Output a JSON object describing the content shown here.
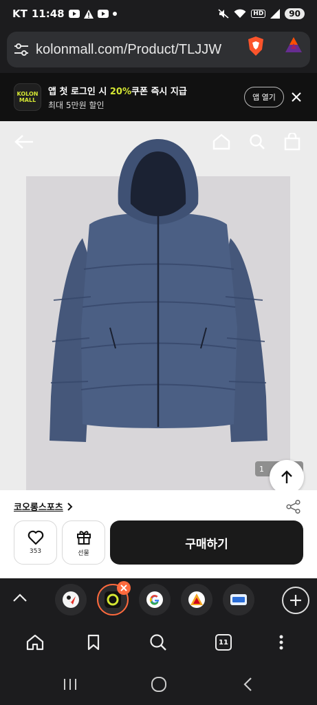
{
  "status_bar": {
    "carrier": "KT",
    "time": "11:48",
    "battery": "90",
    "network_badge": "HD"
  },
  "url_bar": {
    "url": "kolonmall.com/Product/TLJJW"
  },
  "app_banner": {
    "logo_line1": "KOLON",
    "logo_line2": "MALL",
    "title_before": "앱 첫 로그인 시 ",
    "title_highlight": "20%",
    "title_after": "쿠폰 즉시 지급",
    "subtitle": "최대 5만원 할인",
    "open_app_label": "앱 열기",
    "accent_color": "#d4e633"
  },
  "product": {
    "image_counter": "1",
    "brand": "코오롱스포츠",
    "like_count": "353",
    "gift_label": "선물",
    "buy_label": "구매하기"
  },
  "tab_strip": {
    "tabs": [
      {
        "icon": "tab-site-icon-1"
      },
      {
        "icon": "tab-site-icon-active"
      },
      {
        "icon": "google-icon"
      },
      {
        "icon": "tab-site-icon-4"
      },
      {
        "icon": "tab-site-icon-5"
      }
    ],
    "close_color": "#ff6a3d"
  },
  "toolbar": {
    "tabs_count": "11"
  }
}
